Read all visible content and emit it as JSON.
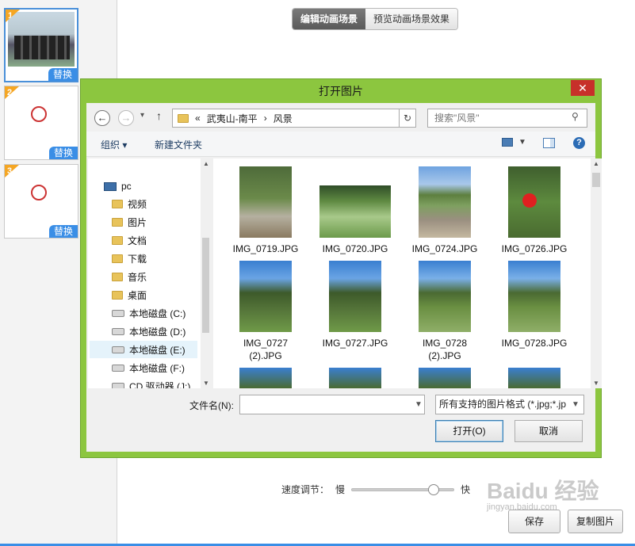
{
  "tabs": {
    "edit": "编辑动画场景",
    "preview": "预览动画场景效果"
  },
  "scenes": [
    {
      "num": "1",
      "replace": "替换"
    },
    {
      "num": "2",
      "replace": "替换"
    },
    {
      "num": "3",
      "replace": "替换"
    }
  ],
  "speed": {
    "label": "速度调节：",
    "slow": "慢",
    "fast": "快"
  },
  "buttons": {
    "save": "保存",
    "copy": "复制图片"
  },
  "watermark": {
    "brand": "Baidu 经验",
    "url": "jingyan.baidu.com"
  },
  "dialog": {
    "title": "打开图片",
    "close": "✕",
    "address": {
      "prefix": "«",
      "path1": "武夷山-南平",
      "sep": "›",
      "path2": "风景"
    },
    "search_placeholder": "搜索\"风景\"",
    "organize": "组织 ▾",
    "new_folder": "新建文件夹",
    "nav": {
      "root": "pc",
      "items": [
        "视频",
        "图片",
        "文档",
        "下载",
        "音乐",
        "桌面",
        "本地磁盘 (C:)",
        "本地磁盘 (D:)",
        "本地磁盘 (E:)",
        "本地磁盘 (F:)",
        "CD 驱动器 (J:)"
      ]
    },
    "files": [
      {
        "name": "IMG_0719.JPG"
      },
      {
        "name": "IMG_0720.JPG"
      },
      {
        "name": "IMG_0724.JPG"
      },
      {
        "name": "IMG_0726.JPG"
      },
      {
        "name": "IMG_0727 (2).JPG"
      },
      {
        "name": "IMG_0727.JPG"
      },
      {
        "name": "IMG_0728 (2).JPG"
      },
      {
        "name": "IMG_0728.JPG"
      }
    ],
    "filename_label": "文件名(N):",
    "filename_value": "",
    "filetype": "所有支持的图片格式 (*.jpg;*.jp",
    "open": "打开(O)",
    "cancel": "取消"
  },
  "colors": {
    "dialog_frame": "#8cc63f",
    "close_red": "#c7302a",
    "accent_blue": "#3a8ee6",
    "badge_orange": "#f5a623"
  }
}
